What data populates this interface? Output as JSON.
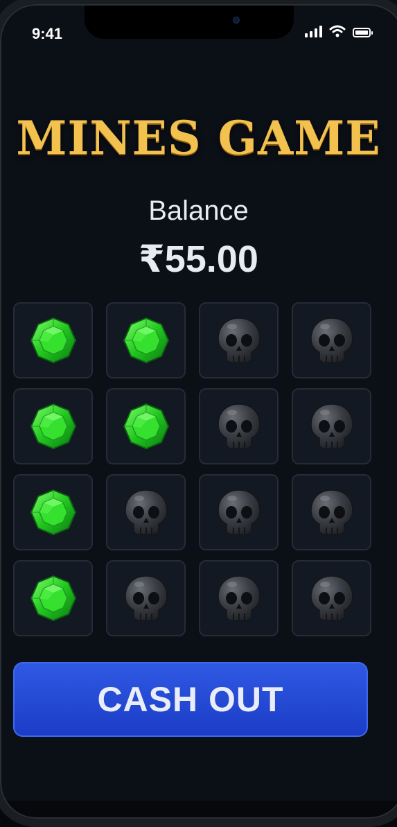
{
  "status_bar": {
    "time": "9:41",
    "icons": [
      "signal-icon",
      "wifi-icon",
      "battery-icon"
    ]
  },
  "header": {
    "title": "MINES GAME",
    "title_color": "#f2c14e"
  },
  "balance": {
    "label": "Balance",
    "value": "₹55.00"
  },
  "board": {
    "rows": 4,
    "cols": 4,
    "tiles": [
      "gem",
      "gem",
      "skull",
      "skull",
      "gem",
      "gem",
      "skull",
      "skull",
      "gem",
      "skull",
      "skull",
      "skull",
      "gem",
      "skull",
      "skull",
      "skull"
    ]
  },
  "actions": {
    "cash_out_label": "CASH OUT",
    "button_color": "#2f59e3"
  },
  "colors": {
    "background": "#0b0f16",
    "gem": "#2ed42a",
    "skull": "#3a3d43"
  }
}
